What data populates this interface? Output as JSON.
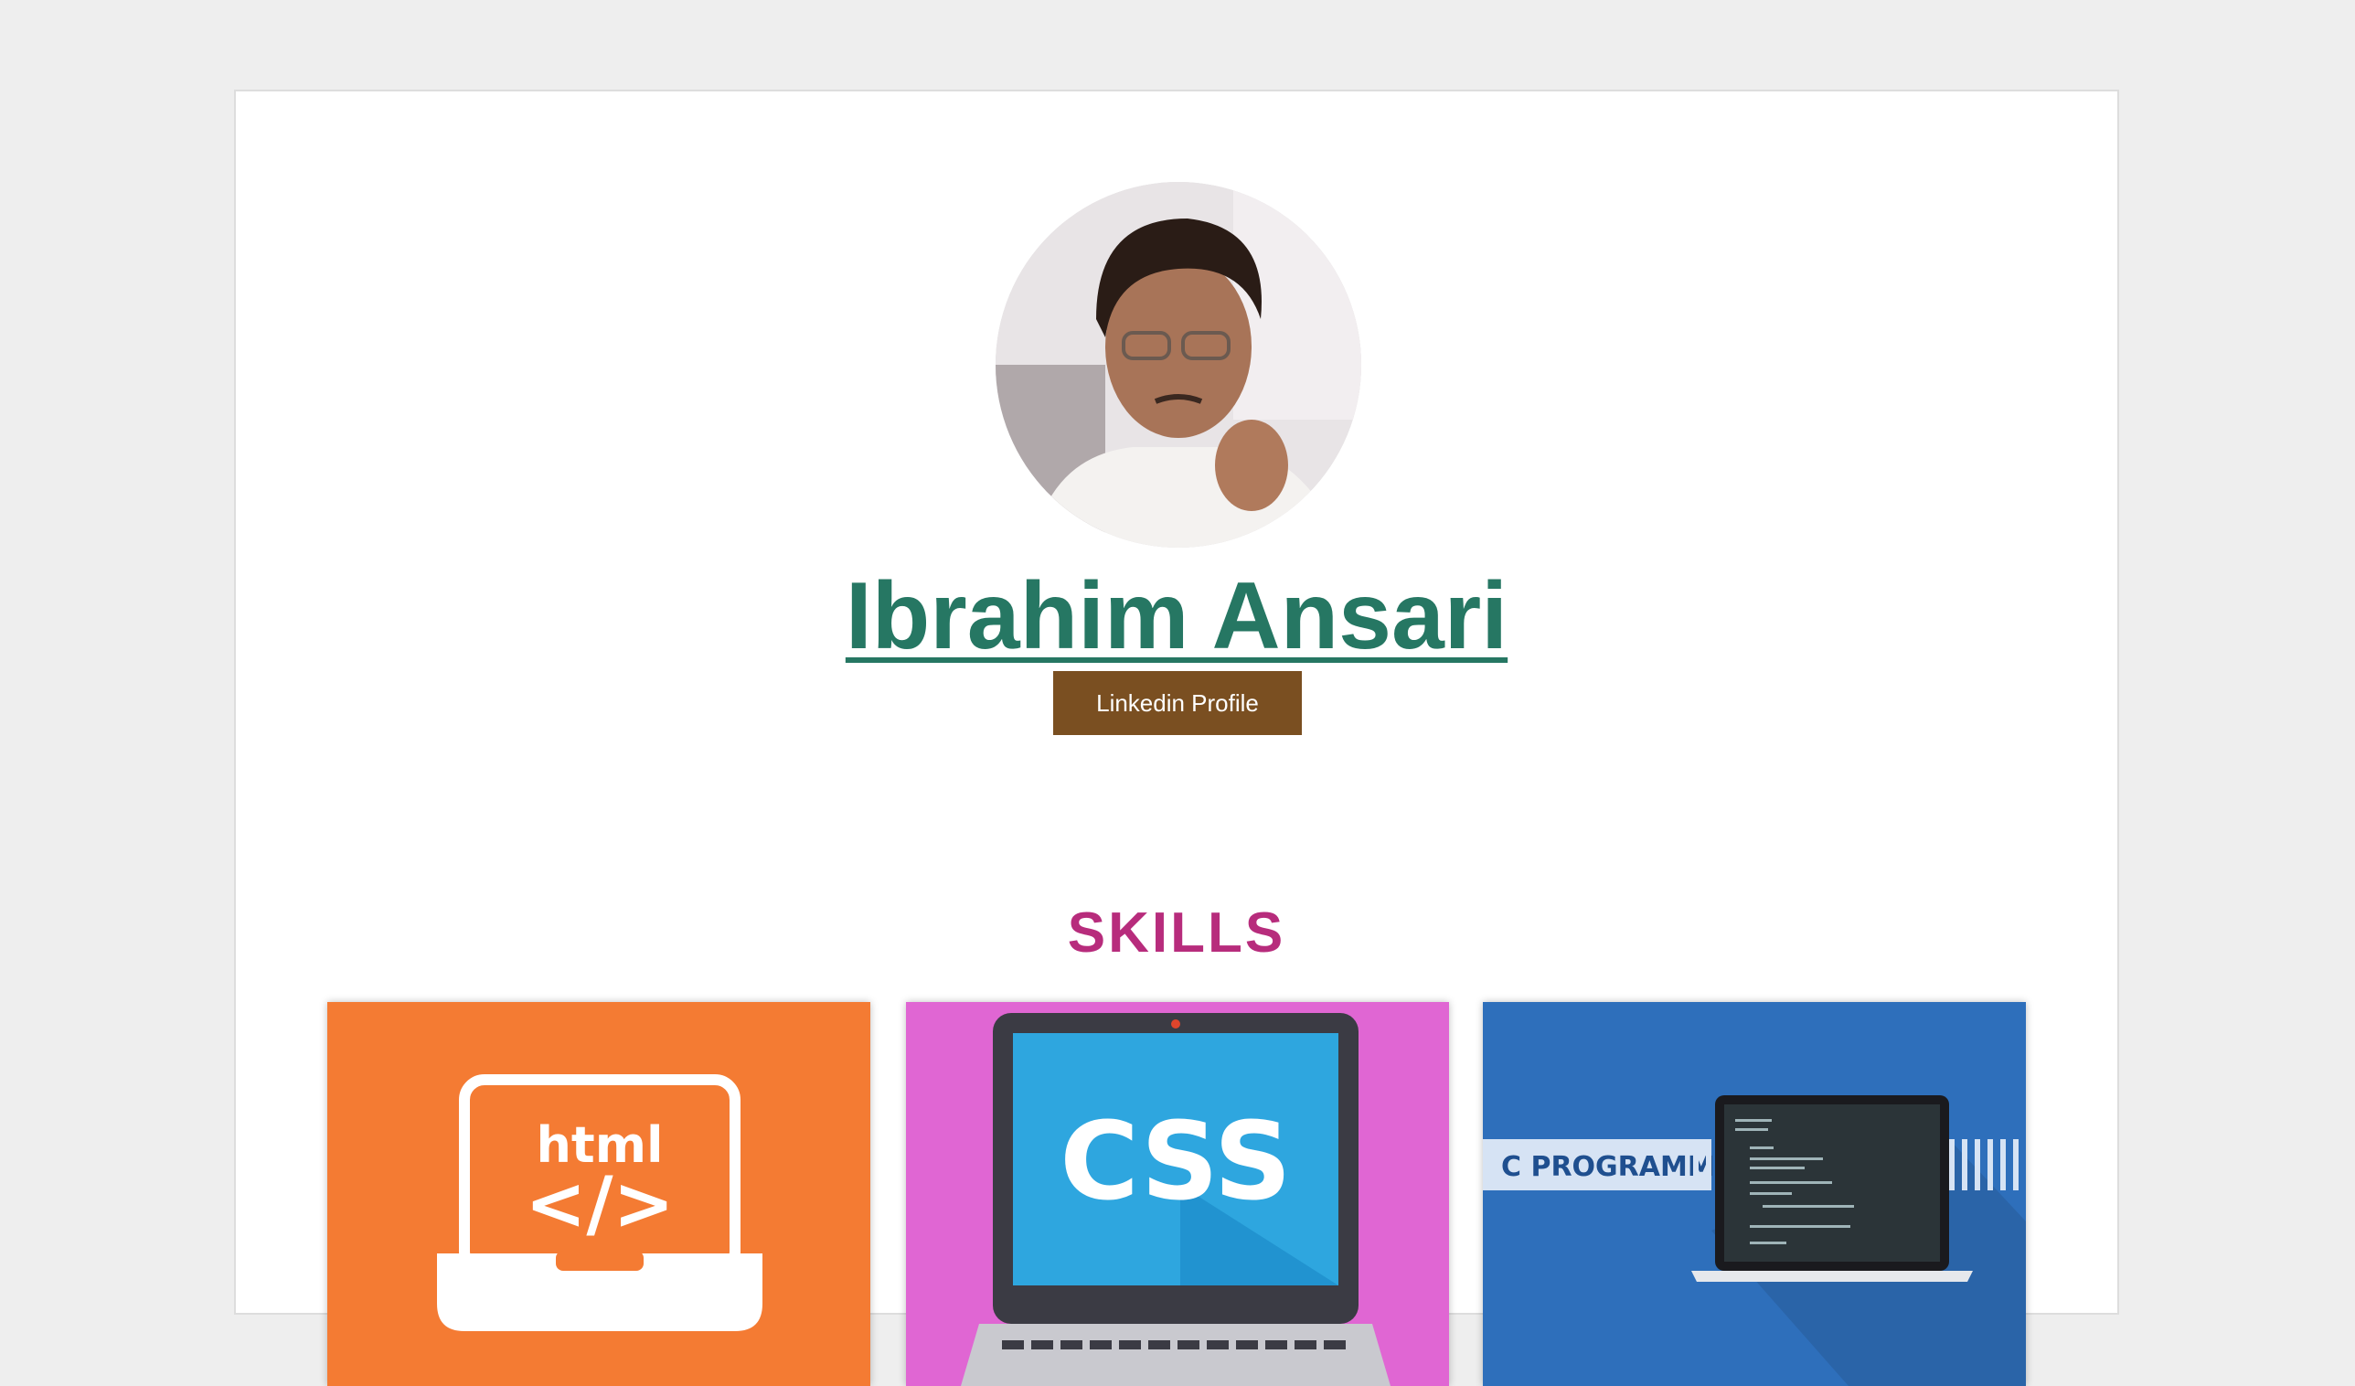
{
  "profile": {
    "name": "Ibrahim Ansari",
    "linkedin_label": "Linkedin Profile"
  },
  "skills": {
    "title": "SKILLS",
    "cards": [
      {
        "label": "html",
        "symbol": "</>",
        "color": "#f47b33"
      },
      {
        "label": "CSS",
        "color": "#e066d3"
      },
      {
        "label": "C PROGRAMMING",
        "color": "#2e6fbb"
      }
    ]
  },
  "colors": {
    "name": "#267763",
    "button": "#7a4f21",
    "skills_title": "#b72c7c",
    "background": "#eeeeee"
  }
}
